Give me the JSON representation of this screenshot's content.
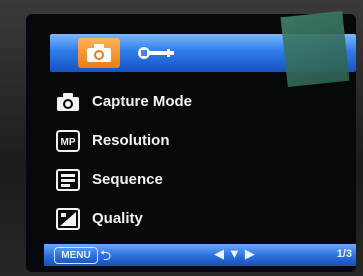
{
  "topbar": {
    "tabs": [
      {
        "name": "camera",
        "icon": "camera-icon",
        "selected": true
      },
      {
        "name": "setup",
        "icon": "wrench-icon",
        "selected": false
      }
    ],
    "accent_color": "#f07a10",
    "bar_color": "#2f7ce8"
  },
  "menu": {
    "items": [
      {
        "label": "Capture Mode",
        "icon": "camera-icon"
      },
      {
        "label": "Resolution",
        "icon": "mp-icon",
        "icon_text": "MP"
      },
      {
        "label": "Sequence",
        "icon": "sequence-icon"
      },
      {
        "label": "Quality",
        "icon": "quality-icon"
      }
    ]
  },
  "bottombar": {
    "menu_label": "MENU",
    "back_icon": "return-arrow-icon",
    "nav_icons": "left-down-right-arrows-icon",
    "page_indicator": "1/3"
  }
}
